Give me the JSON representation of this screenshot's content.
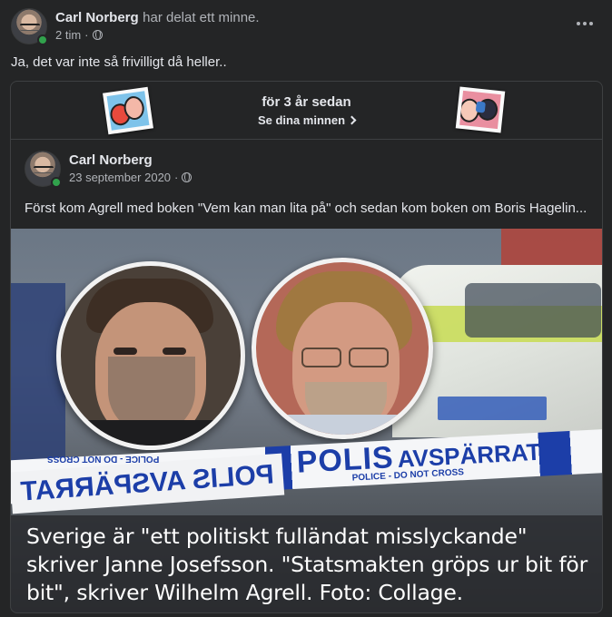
{
  "post": {
    "author": "Carl Norberg",
    "action": "har delat ett minne.",
    "time": "2 tim",
    "dot": "·",
    "text": "Ja, det var inte så frivilligt då heller.."
  },
  "memory": {
    "title": "för 3 år sedan",
    "link_label": "Se dina minnen"
  },
  "original_post": {
    "author": "Carl Norberg",
    "date": "23 september 2020",
    "dot": "·",
    "text": "Först kom Agrell med boken \"Vem kan man lita på\" och sedan kom boken om Boris Hagelin...",
    "image": {
      "tape_text_main": "POLIS",
      "tape_text_sub": "AVSPÄRRAT",
      "tape_small": "POLICE - DO NOT CROSS",
      "tape_mirror": "POLIS AVSPÄRRAT",
      "tape_mirror_small": "POLICE - DO NOT CROSS",
      "caption": "Sverige är \"ett politiskt fulländat misslyckande\" skriver Janne Josefsson. \"Statsmakten gröps ur bit för bit\", skriver Wilhelm Agrell. Foto: Collage."
    }
  },
  "colors": {
    "background": "#242526",
    "text_primary": "#e4e6eb",
    "text_secondary": "#b0b3b8",
    "online": "#31a24c",
    "police_blue": "#1c3ea8"
  }
}
